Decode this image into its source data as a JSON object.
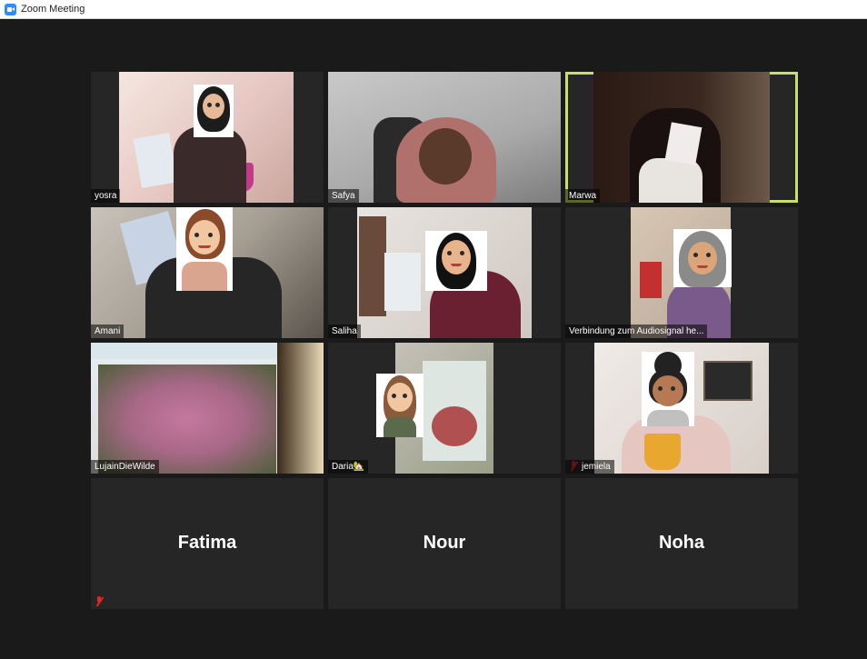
{
  "window": {
    "title": "Zoom Meeting",
    "app_icon": "zoom-icon"
  },
  "colors": {
    "active_speaker": "#c7e25f",
    "tile_bg": "#262626",
    "mute_red": "#e02828"
  },
  "participants": [
    {
      "name": "yosra",
      "video": true,
      "active": false
    },
    {
      "name": "Safya",
      "video": true,
      "active": false
    },
    {
      "name": "Marwa",
      "video": true,
      "active": true
    },
    {
      "name": "Amani",
      "video": true,
      "active": false
    },
    {
      "name": "Saliha",
      "video": true,
      "active": false
    },
    {
      "name": "Verbindung zum Audiosignal he...",
      "video": true,
      "active": false
    },
    {
      "name": "LujainDieWilde",
      "video": true,
      "active": false
    },
    {
      "name": "Daria🏡",
      "video": true,
      "active": false
    },
    {
      "name": "jemiela",
      "video": true,
      "muted": true,
      "active": false
    },
    {
      "name": "Fatima",
      "video": false,
      "muted": true,
      "active": false
    },
    {
      "name": "Nour",
      "video": false,
      "active": false
    },
    {
      "name": "Noha",
      "video": false,
      "active": false
    }
  ]
}
